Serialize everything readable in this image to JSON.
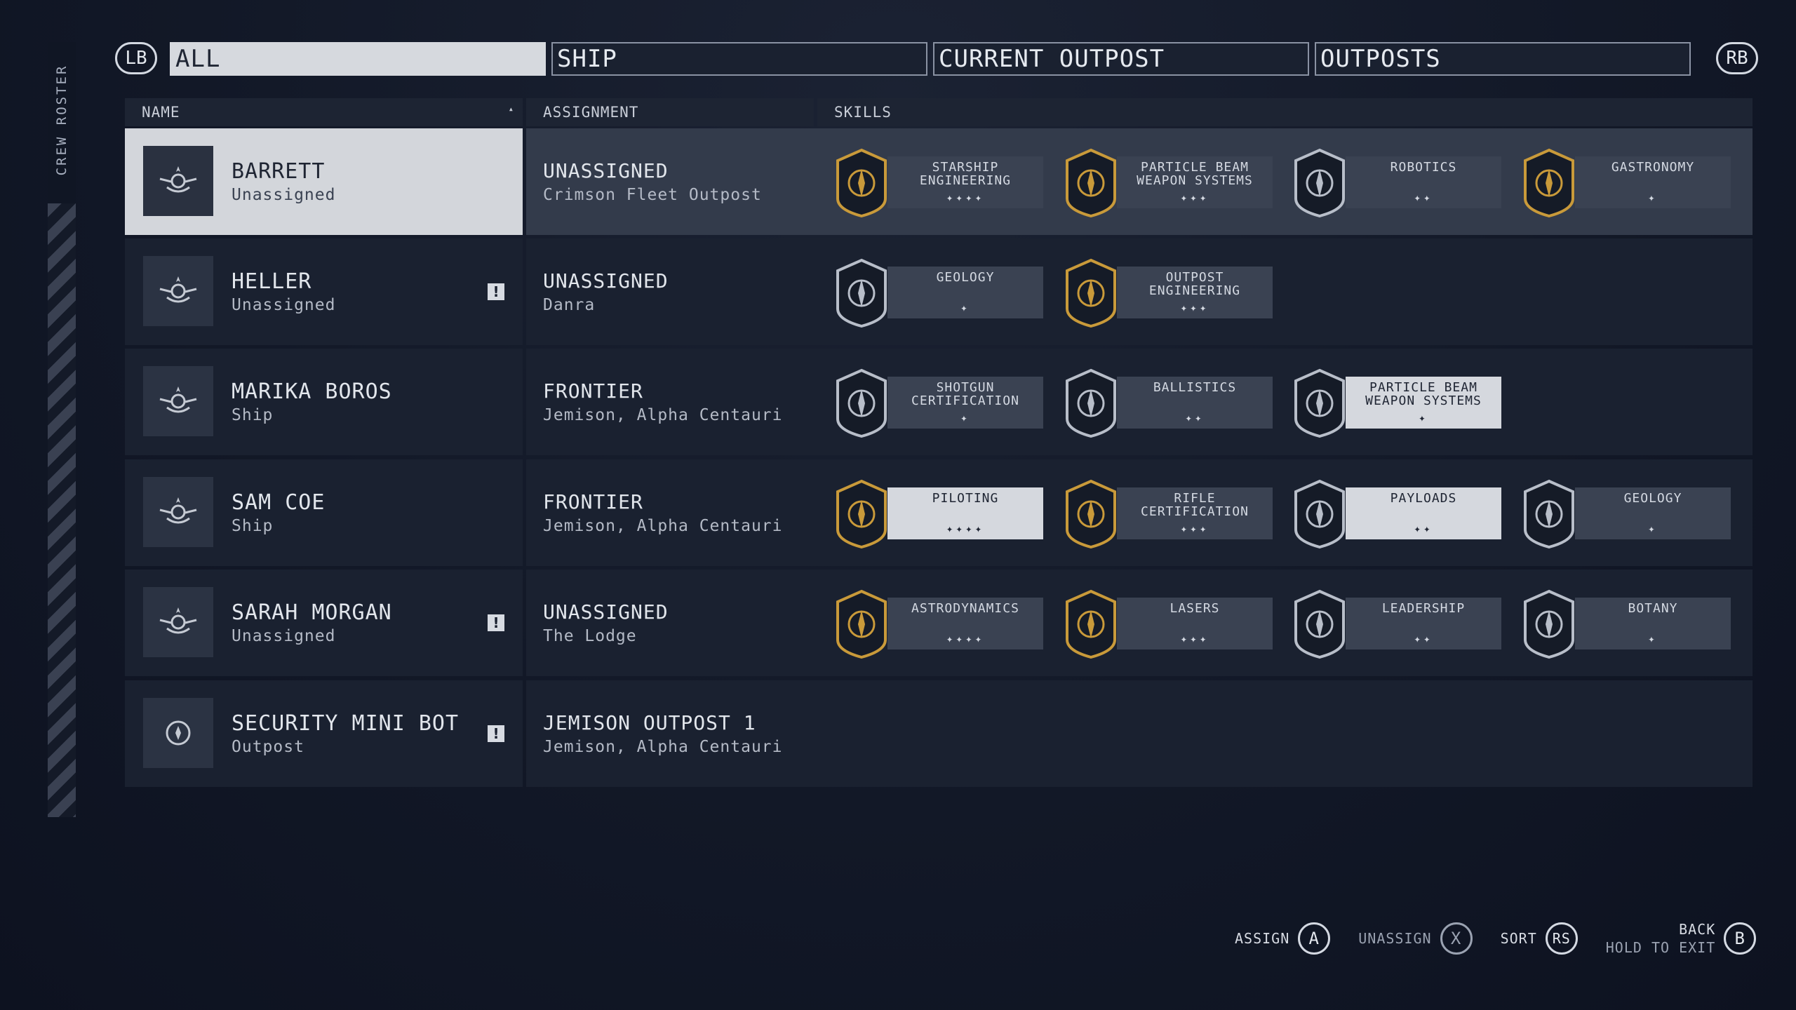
{
  "side_label": "CREW ROSTER",
  "bumpers": {
    "left": "LB",
    "right": "RB"
  },
  "tabs": [
    {
      "label": "ALL"
    },
    {
      "label": "SHIP"
    },
    {
      "label": "CURRENT OUTPOST"
    },
    {
      "label": "OUTPOSTS"
    }
  ],
  "columns": {
    "name": "NAME",
    "assignment": "ASSIGNMENT",
    "skills": "SKILLS"
  },
  "crew": [
    {
      "name": "BARRETT",
      "status": "Unassigned",
      "assignment": "UNASSIGNED",
      "location": "Crimson Fleet Outpost",
      "alert": false,
      "skills": [
        {
          "name": "STARSHIP\nENGINEERING",
          "rank": "✦✦✦✦",
          "icon": "starship-engineering-icon",
          "highlight": false
        },
        {
          "name": "PARTICLE BEAM\nWEAPON SYSTEMS",
          "rank": "✦✦✦",
          "icon": "particle-beam-icon",
          "highlight": false
        },
        {
          "name": "ROBOTICS",
          "rank": "✦✦",
          "icon": "robotics-icon",
          "highlight": false
        },
        {
          "name": "GASTRONOMY",
          "rank": "✦",
          "icon": "gastronomy-icon",
          "highlight": false
        }
      ]
    },
    {
      "name": "HELLER",
      "status": "Unassigned",
      "assignment": "UNASSIGNED",
      "location": "Danra",
      "alert": true,
      "skills": [
        {
          "name": "GEOLOGY",
          "rank": "✦",
          "icon": "geology-icon",
          "highlight": false
        },
        {
          "name": "OUTPOST\nENGINEERING",
          "rank": "✦✦✦",
          "icon": "outpost-engineering-icon",
          "highlight": false
        }
      ]
    },
    {
      "name": "MARIKA BOROS",
      "status": "Ship",
      "assignment": "FRONTIER",
      "location": "Jemison, Alpha Centauri",
      "alert": false,
      "skills": [
        {
          "name": "SHOTGUN\nCERTIFICATION",
          "rank": "✦",
          "icon": "shotgun-icon",
          "highlight": false
        },
        {
          "name": "BALLISTICS",
          "rank": "✦✦",
          "icon": "ballistics-icon",
          "highlight": false
        },
        {
          "name": "PARTICLE BEAM\nWEAPON SYSTEMS",
          "rank": "✦",
          "icon": "particle-beam-icon",
          "highlight": true
        }
      ]
    },
    {
      "name": "SAM COE",
      "status": "Ship",
      "assignment": "FRONTIER",
      "location": "Jemison, Alpha Centauri",
      "alert": false,
      "skills": [
        {
          "name": "PILOTING",
          "rank": "✦✦✦✦",
          "icon": "piloting-icon",
          "highlight": true
        },
        {
          "name": "RIFLE\nCERTIFICATION",
          "rank": "✦✦✦",
          "icon": "rifle-icon",
          "highlight": false
        },
        {
          "name": "PAYLOADS",
          "rank": "✦✦",
          "icon": "payloads-icon",
          "highlight": true
        },
        {
          "name": "GEOLOGY",
          "rank": "✦",
          "icon": "geology-icon",
          "highlight": false
        }
      ]
    },
    {
      "name": "SARAH MORGAN",
      "status": "Unassigned",
      "assignment": "UNASSIGNED",
      "location": "The Lodge",
      "alert": true,
      "skills": [
        {
          "name": "ASTRODYNAMICS",
          "rank": "✦✦✦✦",
          "icon": "astrodynamics-icon",
          "highlight": false
        },
        {
          "name": "LASERS",
          "rank": "✦✦✦",
          "icon": "lasers-icon",
          "highlight": false
        },
        {
          "name": "LEADERSHIP",
          "rank": "✦✦",
          "icon": "leadership-icon",
          "highlight": false
        },
        {
          "name": "BOTANY",
          "rank": "✦",
          "icon": "botany-icon",
          "highlight": false
        }
      ]
    },
    {
      "name": "SECURITY MINI BOT",
      "status": "Outpost",
      "assignment": "JEMISON OUTPOST 1",
      "location": "Jemison, Alpha Centauri",
      "alert": true,
      "skills": []
    }
  ],
  "footer": {
    "assign": "ASSIGN",
    "assign_btn": "A",
    "unassign": "UNASSIGN",
    "unassign_btn": "X",
    "sort": "SORT",
    "sort_btn": "RS",
    "back": "BACK",
    "hold": "HOLD TO EXIT",
    "back_btn": "B"
  },
  "colors": {
    "gold": "#c99a3a",
    "panel": "#1a2130",
    "selected": "#d3d6db"
  }
}
